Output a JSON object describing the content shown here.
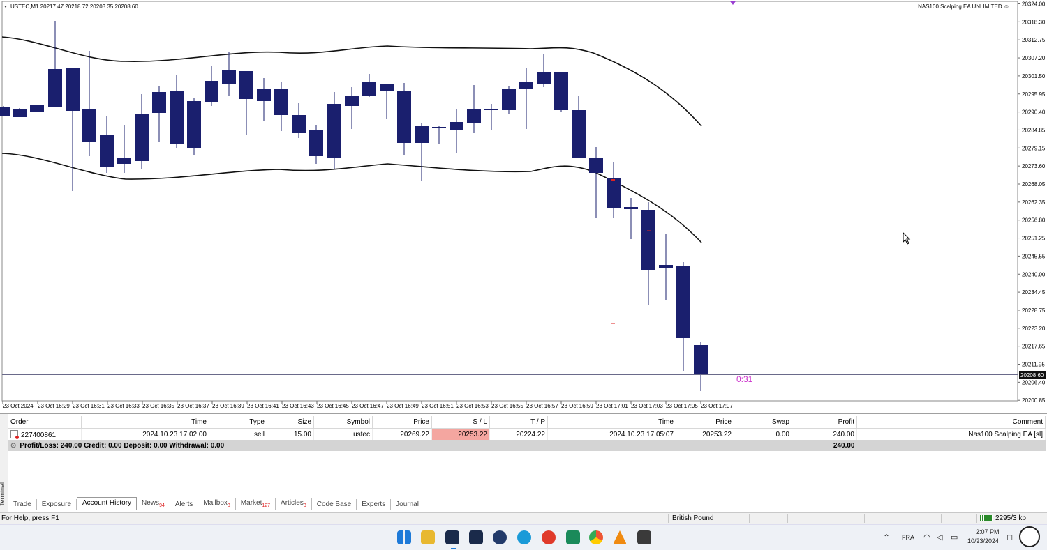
{
  "chart": {
    "header": "USTEC,M1  20217.47 20218.72 20203.35 20208.60",
    "ea_label": "NAS100 Scalping EA UNLIMITED ☺",
    "countdown": "0:31",
    "current_price_label": "20208.60",
    "candle_color": "#1a1f6e",
    "price_ticks": [
      "20324.00",
      "20318.30",
      "20312.75",
      "20307.20",
      "20301.50",
      "20295.95",
      "20290.40",
      "20284.85",
      "20279.15",
      "20273.60",
      "20268.05",
      "20262.35",
      "20256.80",
      "20251.25",
      "20245.55",
      "20240.00",
      "20234.45",
      "20228.75",
      "20223.20",
      "20217.65",
      "20211.95",
      "20206.40",
      "20200.85"
    ],
    "time_ticks": [
      "23 Oct 2024",
      "23 Oct 16:29",
      "23 Oct 16:31",
      "23 Oct 16:33",
      "23 Oct 16:35",
      "23 Oct 16:37",
      "23 Oct 16:39",
      "23 Oct 16:41",
      "23 Oct 16:43",
      "23 Oct 16:45",
      "23 Oct 16:47",
      "23 Oct 16:49",
      "23 Oct 16:51",
      "23 Oct 16:53",
      "23 Oct 16:55",
      "23 Oct 16:57",
      "23 Oct 16:59",
      "23 Oct 17:01",
      "23 Oct 17:03",
      "23 Oct 17:05",
      "23 Oct 17:07"
    ]
  },
  "terminal": {
    "side_label": "Terminal",
    "columns": [
      "Order",
      "Time",
      "Type",
      "Size",
      "Symbol",
      "Price",
      "S / L",
      "T / P",
      "Time",
      "Price",
      "Swap",
      "Profit",
      "Comment"
    ],
    "rows": [
      {
        "order": "227400861",
        "time": "2024.10.23 17:02:00",
        "type": "sell",
        "size": "15.00",
        "symbol": "ustec",
        "price": "20269.22",
        "sl": "20253.22",
        "tp": "20224.22",
        "close_time": "2024.10.23 17:05:07",
        "close_price": "20253.22",
        "swap": "0.00",
        "profit": "240.00",
        "comment": "Nas100 Scalping EA [sl]"
      }
    ],
    "summary": "Profit/Loss: 240.00  Credit: 0.00  Deposit: 0.00  Withdrawal: 0.00",
    "summary_profit": "240.00",
    "tabs": [
      {
        "label": "Trade",
        "badge": ""
      },
      {
        "label": "Exposure",
        "badge": ""
      },
      {
        "label": "Account History",
        "badge": ""
      },
      {
        "label": "News",
        "badge": "94"
      },
      {
        "label": "Alerts",
        "badge": ""
      },
      {
        "label": "Mailbox",
        "badge": "3"
      },
      {
        "label": "Market",
        "badge": "127"
      },
      {
        "label": "Articles",
        "badge": "3"
      },
      {
        "label": "Code Base",
        "badge": ""
      },
      {
        "label": "Experts",
        "badge": ""
      },
      {
        "label": "Journal",
        "badge": ""
      }
    ]
  },
  "statusbar": {
    "help": "For Help, press F1",
    "profile": "British Pound",
    "traffic": "2295/3 kb"
  },
  "taskbar": {
    "language": "FRA",
    "time": "2:07 PM",
    "date": "10/23/2024"
  }
}
